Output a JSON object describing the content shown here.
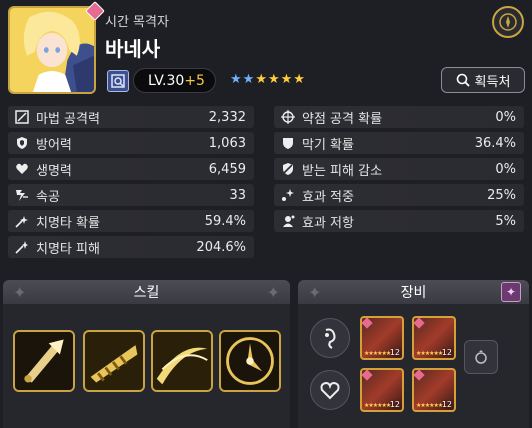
{
  "character": {
    "epithet": "시간 목격자",
    "name": "바네사",
    "level_label": "LV.30",
    "level_bonus": "+5",
    "stars": [
      {
        "color": "blue"
      },
      {
        "color": "blue"
      },
      {
        "color": "gold"
      },
      {
        "color": "gold"
      },
      {
        "color": "gold"
      },
      {
        "color": "gold"
      }
    ],
    "element_icon": "moon-element-icon"
  },
  "header": {
    "acquire_label": "획득처",
    "compass_icon": "compass-icon"
  },
  "stats_left": [
    {
      "icon": "magic-attack-icon",
      "label": "마법 공격력",
      "value": "2,332"
    },
    {
      "icon": "defense-icon",
      "label": "방어력",
      "value": "1,063"
    },
    {
      "icon": "heart-icon",
      "label": "생명력",
      "value": "6,459"
    },
    {
      "icon": "speed-icon",
      "label": "속공",
      "value": "33"
    },
    {
      "icon": "crit-rate-icon",
      "label": "치명타 확률",
      "value": "59.4%"
    },
    {
      "icon": "crit-damage-icon",
      "label": "치명타 피해",
      "value": "204.6%"
    }
  ],
  "stats_right": [
    {
      "icon": "weakness-icon",
      "label": "약점 공격 확률",
      "value": "0%"
    },
    {
      "icon": "block-icon",
      "label": "막기 확률",
      "value": "36.4%"
    },
    {
      "icon": "damage-reduction-icon",
      "label": "받는 피해 감소",
      "value": "0%"
    },
    {
      "icon": "effect-hit-icon",
      "label": "효과 적중",
      "value": "25%"
    },
    {
      "icon": "effect-resist-icon",
      "label": "효과 저항",
      "value": "5%"
    }
  ],
  "skills": {
    "title": "스킬",
    "items": [
      {
        "icon": "dagger-skill-icon"
      },
      {
        "icon": "drill-skill-icon"
      },
      {
        "icon": "slash-skill-icon"
      },
      {
        "icon": "clock-skill-icon"
      }
    ]
  },
  "equipment": {
    "title": "장비",
    "set_a": {
      "items": [
        {
          "level": "12"
        },
        {
          "level": "12"
        }
      ]
    },
    "set_b": {
      "items": [
        {
          "level": "12"
        },
        {
          "level": "12"
        }
      ]
    },
    "ring_icon": "ring-icon"
  },
  "colors": {
    "background": "#1e1f24",
    "gold_accent": "#c9a442",
    "bonus_text": "#f1c94a",
    "row_bg": "#2d2e34"
  }
}
